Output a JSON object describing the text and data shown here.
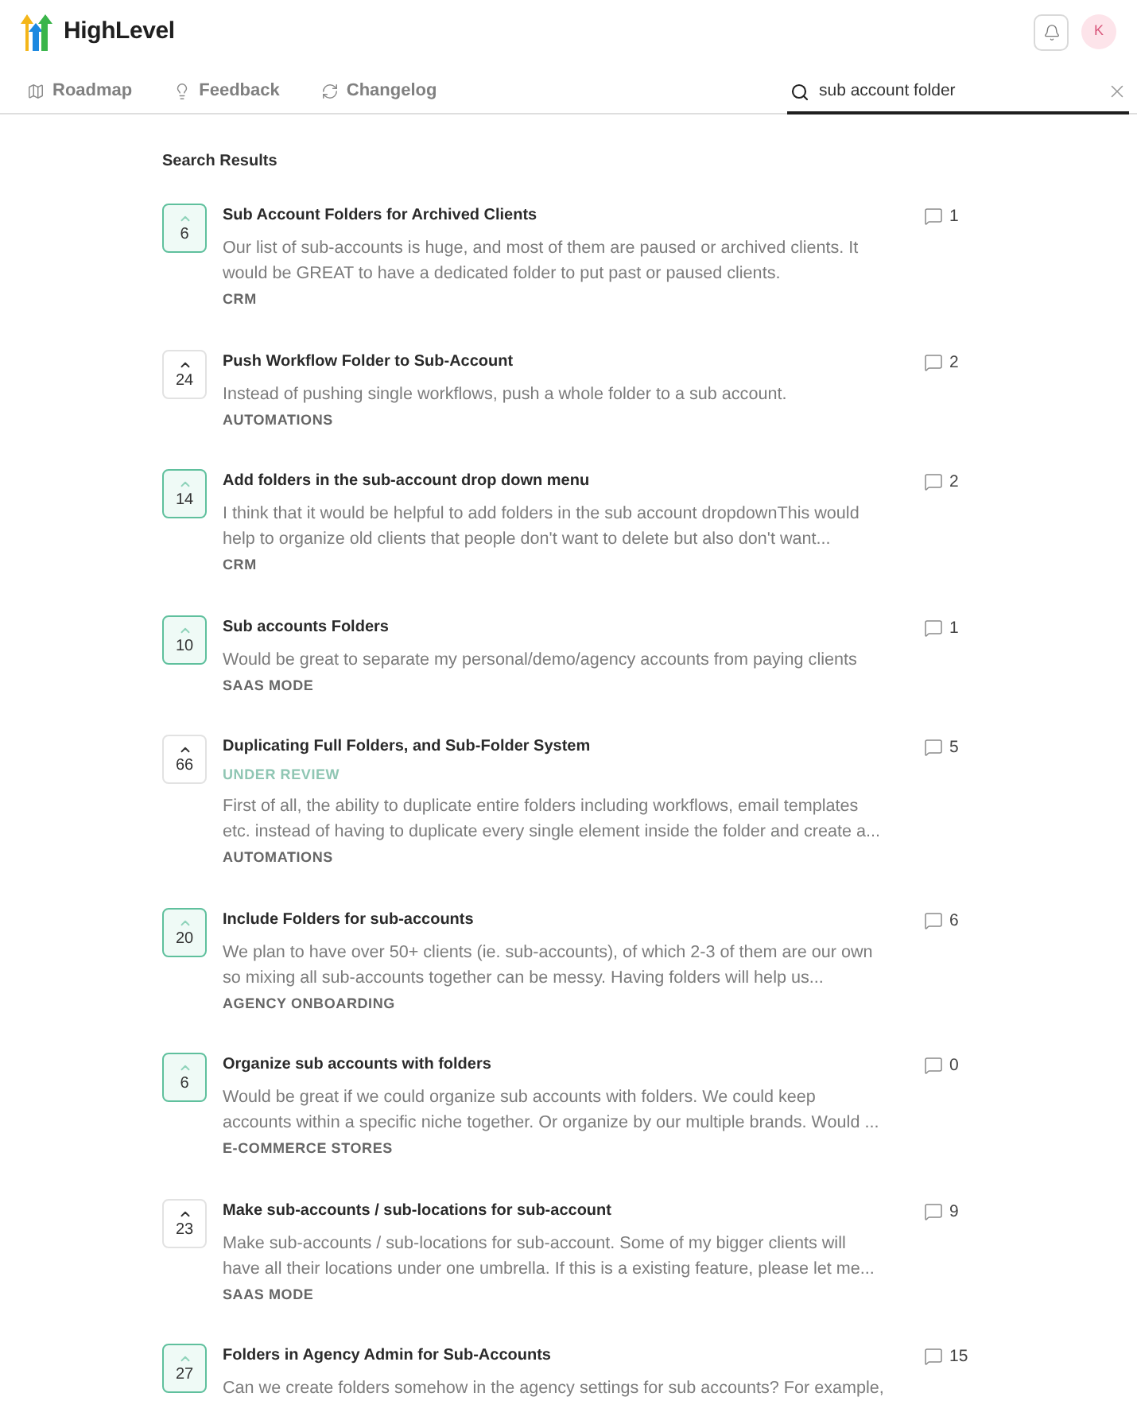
{
  "app": {
    "name": "HighLevel",
    "avatar_initial": "K"
  },
  "nav": {
    "tabs": [
      {
        "label": "Roadmap",
        "selected": false
      },
      {
        "label": "Feedback",
        "selected": false
      },
      {
        "label": "Changelog",
        "selected": false
      }
    ]
  },
  "search": {
    "value": "sub account folder"
  },
  "results": {
    "heading": "Search Results",
    "items": [
      {
        "title": "Sub Account Folders for Archived Clients",
        "votes": "6",
        "voted": true,
        "comments": "1",
        "description_lines": [
          "Our list of sub-accounts is huge, and most of them are paused or archived clients. It",
          "would be GREAT to have a dedicated folder to put past or paused clients."
        ],
        "category": "CRM"
      },
      {
        "title": "Push Workflow Folder to Sub-Account",
        "votes": "24",
        "voted": false,
        "comments": "2",
        "description_lines": [
          "Instead of pushing single workflows, push a whole folder to a sub account."
        ],
        "category": "AUTOMATIONS"
      },
      {
        "title": "Add folders in the sub-account drop down menu",
        "votes": "14",
        "voted": true,
        "comments": "2",
        "description_lines": [
          "I think that it would be helpful to add folders in the sub account dropdownThis would",
          "help to organize old clients that people don't want to delete but also don't want..."
        ],
        "category": "CRM"
      },
      {
        "title": "Sub accounts Folders",
        "votes": "10",
        "voted": true,
        "comments": "1",
        "description_lines": [
          "Would be great to separate my personal/demo/agency accounts from paying clients"
        ],
        "category": "SAAS MODE"
      },
      {
        "title": "Duplicating Full Folders, and Sub-Folder System",
        "votes": "66",
        "voted": false,
        "comments": "5",
        "status": "UNDER REVIEW",
        "description_lines": [
          "First of all, the ability to duplicate entire folders including workflows, email templates",
          "etc. instead of having to duplicate every single element inside the folder and create a..."
        ],
        "category": "AUTOMATIONS"
      },
      {
        "title": "Include Folders for sub-accounts",
        "votes": "20",
        "voted": true,
        "comments": "6",
        "description_lines": [
          "We plan to have over 50+ clients (ie. sub-accounts), of which 2-3 of them are our own",
          "so mixing all sub-accounts together can be messy. Having folders will help us..."
        ],
        "category": "AGENCY ONBOARDING"
      },
      {
        "title": "Organize sub accounts with folders",
        "votes": "6",
        "voted": true,
        "comments": "0",
        "description_lines": [
          "Would be great if we could organize sub accounts with folders. We could keep",
          "accounts within a specific niche together. Or organize by our multiple brands. Would ..."
        ],
        "category": "E-COMMERCE STORES"
      },
      {
        "title": "Make sub-accounts / sub-locations for sub-account",
        "votes": "23",
        "voted": false,
        "comments": "9",
        "description_lines": [
          "Make sub-accounts / sub-locations for sub-account. Some of my bigger clients will",
          "have all their locations under one umbrella. If this is a existing feature, please let me..."
        ],
        "category": "SAAS MODE"
      },
      {
        "title": "Folders in Agency Admin for Sub-Accounts",
        "votes": "27",
        "voted": true,
        "comments": "15",
        "description_lines": [
          "Can we create folders somehow in the agency settings for sub accounts? For example,"
        ]
      }
    ]
  }
}
